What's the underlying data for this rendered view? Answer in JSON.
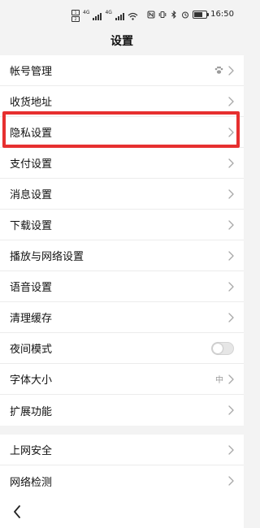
{
  "status_bar": {
    "sim1": "1",
    "sim2": "2",
    "net1": "4G",
    "net2": "4G",
    "time": "16:50"
  },
  "title": "设置",
  "groups": [
    {
      "items": [
        {
          "label": "帐号管理",
          "icon": "paw-icon"
        },
        {
          "label": "收货地址"
        },
        {
          "label": "隐私设置",
          "highlighted": true
        },
        {
          "label": "支付设置"
        },
        {
          "label": "消息设置"
        },
        {
          "label": "下载设置"
        },
        {
          "label": "播放与网络设置"
        },
        {
          "label": "语音设置"
        },
        {
          "label": "清理缓存"
        },
        {
          "label": "夜间模式",
          "toggle": false
        },
        {
          "label": "字体大小",
          "value": "中"
        },
        {
          "label": "扩展功能"
        }
      ]
    },
    {
      "items": [
        {
          "label": "上网安全"
        },
        {
          "label": "网络检测"
        }
      ]
    }
  ],
  "colors": {
    "highlight": "#e62f2f",
    "background": "#f3f3f3"
  }
}
